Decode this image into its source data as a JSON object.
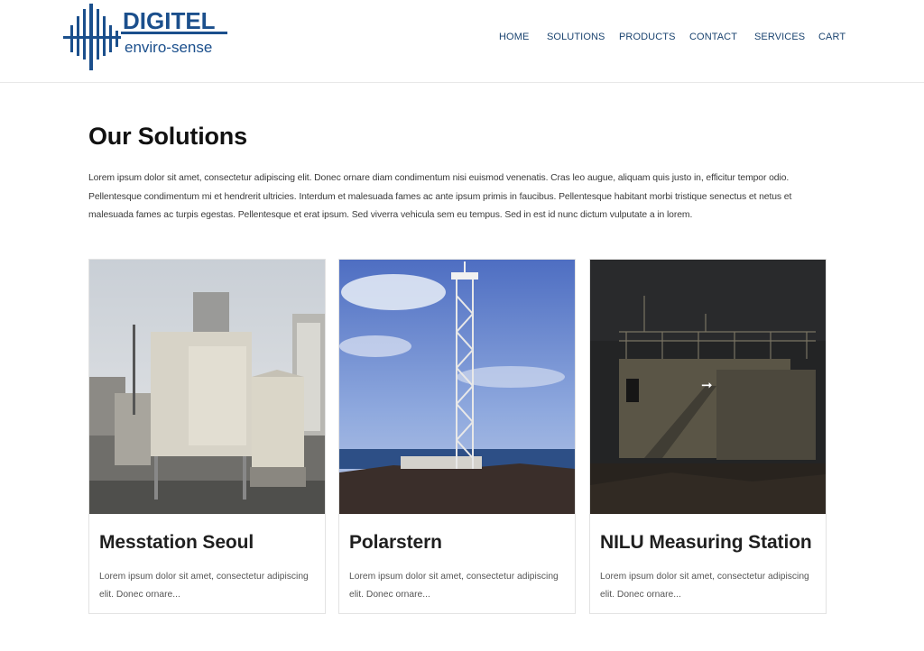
{
  "brand": {
    "name": "DIGITEL",
    "tagline": "enviro-sense",
    "color": "#1b4f8c"
  },
  "nav": {
    "items": [
      {
        "label": "HOME"
      },
      {
        "label": "SOLUTIONS"
      },
      {
        "label": "PRODUCTS"
      },
      {
        "label": "CONTACT"
      },
      {
        "label": "SERVICES"
      },
      {
        "label": "CART"
      }
    ]
  },
  "main": {
    "title": "Our Solutions",
    "intro": "Lorem ipsum dolor sit amet, consectetur adipiscing elit. Donec ornare diam condimentum nisi euismod venenatis. Cras leo augue, aliquam quis justo in, efficitur tempor odio. Pellentesque condimentum mi et hendrerit ultricies. Interdum et malesuada fames ac ante ipsum primis in faucibus. Pellentesque habitant morbi tristique senectus et netus et malesuada fames ac turpis egestas. Pellentesque et erat ipsum. Sed viverra vehicula sem eu tempus. Sed in est id nunc dictum vulputate a in lorem."
  },
  "cards": [
    {
      "title": "Messtation Seoul",
      "text": "Lorem ipsum dolor sit amet, consectetur adipiscing elit. Donec ornare..."
    },
    {
      "title": "Polarstern",
      "text": "Lorem ipsum dolor sit amet, consectetur adipiscing elit. Donec ornare..."
    },
    {
      "title": "NILU Measuring Station",
      "text": "Lorem ipsum dolor sit amet, consectetur adipiscing elit. Donec ornare...",
      "hover_icon": "arrow-right-icon"
    }
  ]
}
